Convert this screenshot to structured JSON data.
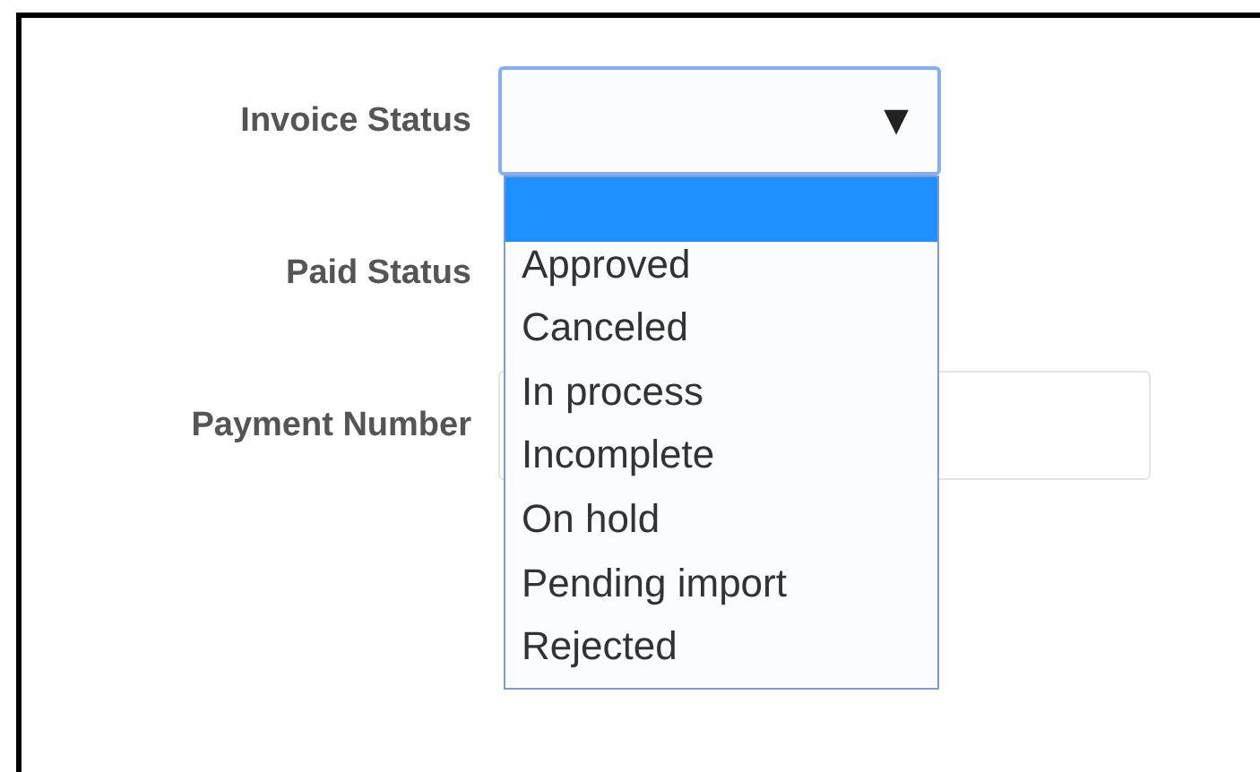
{
  "fields": [
    {
      "label": "Invoice Status",
      "kind": "select",
      "arrow": "▼",
      "expanded": true,
      "options": [
        {
          "selected": true
        },
        {
          "label": "Approved",
          "selected": false
        },
        {
          "label": "Canceled",
          "selected": false
        },
        {
          "label": "In process",
          "selected": false
        },
        {
          "label": "Incomplete",
          "selected": false
        },
        {
          "label": "On hold",
          "selected": false
        },
        {
          "label": "Pending import",
          "selected": false
        },
        {
          "label": "Rejected",
          "selected": false
        }
      ]
    },
    {
      "label": "Paid Status"
    },
    {
      "label": "Payment Number",
      "kind": "input"
    }
  ]
}
